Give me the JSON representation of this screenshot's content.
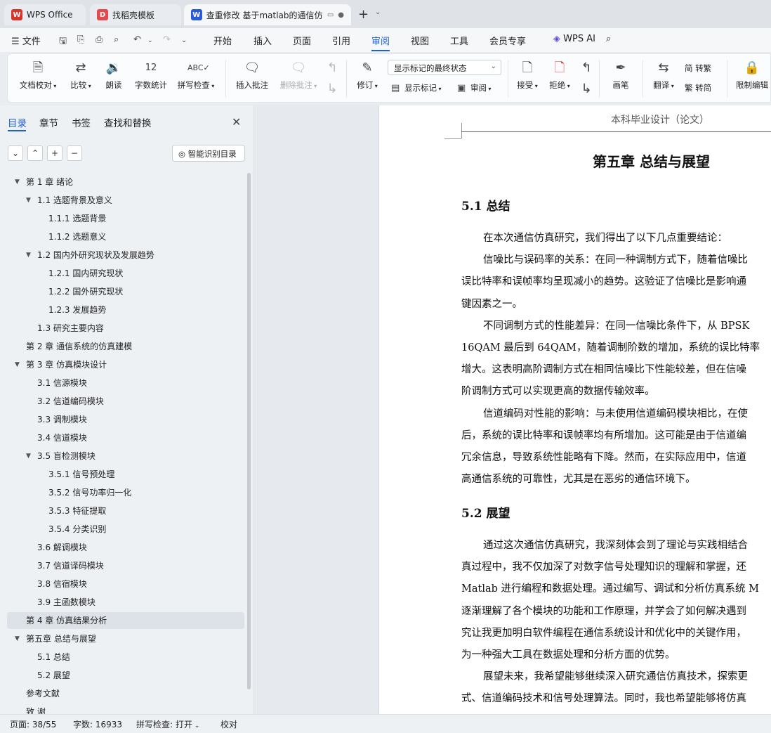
{
  "tabs": [
    {
      "label": "WPS Office",
      "icon": "wps-logo-icon",
      "color": "#d8342c"
    },
    {
      "label": "找稻壳模板",
      "icon": "docer-icon",
      "color": "#e5484d"
    },
    {
      "label": "查重修改 基于matlab的通信仿",
      "icon": "word-doc-icon",
      "color": "#2a5bd7"
    }
  ],
  "menu": {
    "file": "文件",
    "items": [
      "开始",
      "插入",
      "页面",
      "引用",
      "审阅",
      "视图",
      "工具",
      "会员专享"
    ],
    "active": "审阅",
    "wps_ai": "WPS AI"
  },
  "ribbon": {
    "doc_check": "文档校对",
    "compare": "比较",
    "read_aloud": "朗读",
    "word_count": "字数统计",
    "spell_check": "拼写检查",
    "insert_comment": "插入批注",
    "delete_comment": "删除批注",
    "revise": "修订",
    "markup_state": "显示标记的最终状态",
    "show_markup": "显示标记",
    "review": "审阅",
    "accept": "接受",
    "reject": "拒绝",
    "pen": "画笔",
    "translate": "翻译",
    "to_traditional": "简 转繁",
    "to_simplified": "繁 转简",
    "restrict_edit": "限制编辑"
  },
  "nav": {
    "tabs": [
      "目录",
      "章节",
      "书签",
      "查找和替换"
    ],
    "smart_toc": "智能识别目录",
    "toc": [
      {
        "text": "第 1 章  绪论",
        "level": 0,
        "expanded": true
      },
      {
        "text": "1.1 选题背景及意义",
        "level": 1,
        "expanded": true
      },
      {
        "text": "1.1.1 选题背景",
        "level": 2
      },
      {
        "text": "1.1.2 选题意义",
        "level": 2
      },
      {
        "text": "1.2 国内外研究现状及发展趋势",
        "level": 1,
        "expanded": true
      },
      {
        "text": "1.2.1 国内研究现状",
        "level": 2
      },
      {
        "text": "1.2.2 国外研究现状",
        "level": 2
      },
      {
        "text": "1.2.3 发展趋势",
        "level": 2
      },
      {
        "text": "1.3 研究主要内容",
        "level": 1
      },
      {
        "text": "第 2 章  通信系统的仿真建模",
        "level": 0
      },
      {
        "text": "第 3 章  仿真模块设计",
        "level": 0,
        "expanded": true
      },
      {
        "text": "3.1 信源模块",
        "level": 1
      },
      {
        "text": "3.2 信道编码模块",
        "level": 1
      },
      {
        "text": "3.3 调制模块",
        "level": 1
      },
      {
        "text": "3.4 信道模块",
        "level": 1
      },
      {
        "text": "3.5 盲检测模块",
        "level": 1,
        "expanded": true
      },
      {
        "text": "3.5.1 信号预处理",
        "level": 2
      },
      {
        "text": "3.5.2 信号功率归一化",
        "level": 2
      },
      {
        "text": "3.5.3 特征提取",
        "level": 2
      },
      {
        "text": "3.5.4 分类识别",
        "level": 2
      },
      {
        "text": "3.6  解调模块",
        "level": 1
      },
      {
        "text": "3.7 信道译码模块",
        "level": 1
      },
      {
        "text": "3.8 信宿模块",
        "level": 1
      },
      {
        "text": "3.9  主函数模块",
        "level": 1
      },
      {
        "text": "第 4 章  仿真结果分析",
        "level": 0,
        "selected": true
      },
      {
        "text": "第五章  总结与展望",
        "level": 0,
        "expanded": true
      },
      {
        "text": "5.1 总结",
        "level": 1
      },
      {
        "text": "5.2 展望",
        "level": 1
      },
      {
        "text": "参考文献",
        "level": 0
      },
      {
        "text": "致   谢",
        "level": 0
      }
    ]
  },
  "document": {
    "header": "本科毕业设计（论文）",
    "chapter_title": "第五章  总结与展望",
    "sec1_title": "5.1 总结",
    "sec2_title": "5.2 展望",
    "sec1_lines": [
      {
        "text": "在本次通信仿真研究，我们得出了以下几点重要结论：",
        "indent": true
      },
      {
        "text": "信噪比与误码率的关系：在同一种调制方式下，随着信噪比",
        "indent": true
      },
      {
        "text": "误比特率和误帧率均呈现减小的趋势。这验证了信噪比是影响通",
        "indent": false
      },
      {
        "text": "键因素之一。",
        "indent": false
      },
      {
        "text": "不同调制方式的性能差异：在同一信噪比条件下，从 BPSK",
        "indent": true
      },
      {
        "text": "16QAM 最后到 64QAM，随着调制阶数的增加，系统的误比特率",
        "indent": false
      },
      {
        "text": "增大。这表明高阶调制方式在相同信噪比下性能较差，但在信噪",
        "indent": false
      },
      {
        "text": "阶调制方式可以实现更高的数据传输效率。",
        "indent": false
      },
      {
        "text": "信道编码对性能的影响：与未使用信道编码模块相比，在使",
        "indent": true
      },
      {
        "text": "后，系统的误比特率和误帧率均有所增加。这可能是由于信道编",
        "indent": false
      },
      {
        "text": "冗余信息，导致系统性能略有下降。然而，在实际应用中，信道",
        "indent": false
      },
      {
        "text": "高通信系统的可靠性，尤其是在恶劣的通信环境下。",
        "indent": false
      }
    ],
    "sec2_lines": [
      {
        "text": "通过这次通信仿真研究，我深刻体会到了理论与实践相结合",
        "indent": true
      },
      {
        "text": "真过程中，我不仅加深了对数字信号处理知识的理解和掌握，还",
        "indent": false
      },
      {
        "text": "Matlab 进行编程和数据处理。通过编写、调试和分析仿真系统 M",
        "indent": false
      },
      {
        "text": "逐渐理解了各个模块的功能和工作原理，并学会了如何解决遇到",
        "indent": false
      },
      {
        "text": "究让我更加明白软件编程在通信系统设计和优化中的关键作用，",
        "indent": false
      },
      {
        "text": "为一种强大工具在数据处理和分析方面的优势。",
        "indent": false
      },
      {
        "text": "展望未来，我希望能够继续深入研究通信仿真技术，探索更",
        "indent": true
      },
      {
        "text": "式、信道编码技术和信号处理算法。同时，我也希望能够将仿真",
        "indent": false
      }
    ]
  },
  "status": {
    "page": "页面: 38/55",
    "words": "字数: 16933",
    "spell": "拼写检查: 打开",
    "proof": "校对"
  },
  "colors": {
    "accent": "#1f5fd6"
  }
}
